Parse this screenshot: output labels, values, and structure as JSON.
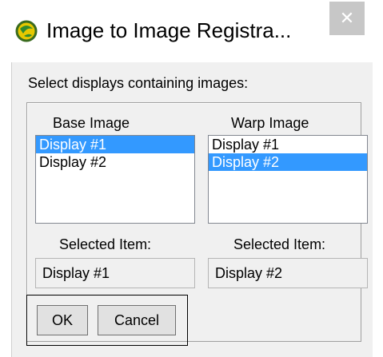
{
  "window": {
    "title": "Image to Image Registra...",
    "close_glyph": "✕",
    "icon": "envi-globe-icon"
  },
  "dialog": {
    "instruction": "Select displays containing images:",
    "base": {
      "label": "Base Image",
      "items": [
        "Display #1",
        "Display #2"
      ],
      "selected_index": 0,
      "selected_label": "Selected Item:",
      "selected_value": "Display #1"
    },
    "warp": {
      "label": "Warp Image",
      "items": [
        "Display #1",
        "Display #2"
      ],
      "selected_index": 1,
      "selected_label": "Selected Item:",
      "selected_value": "Display #2"
    },
    "buttons": {
      "ok": "OK",
      "cancel": "Cancel"
    }
  },
  "colors": {
    "selection": "#3399ff",
    "dialog_bg": "#f0f0f0",
    "close_bg": "#c7c7c7"
  }
}
